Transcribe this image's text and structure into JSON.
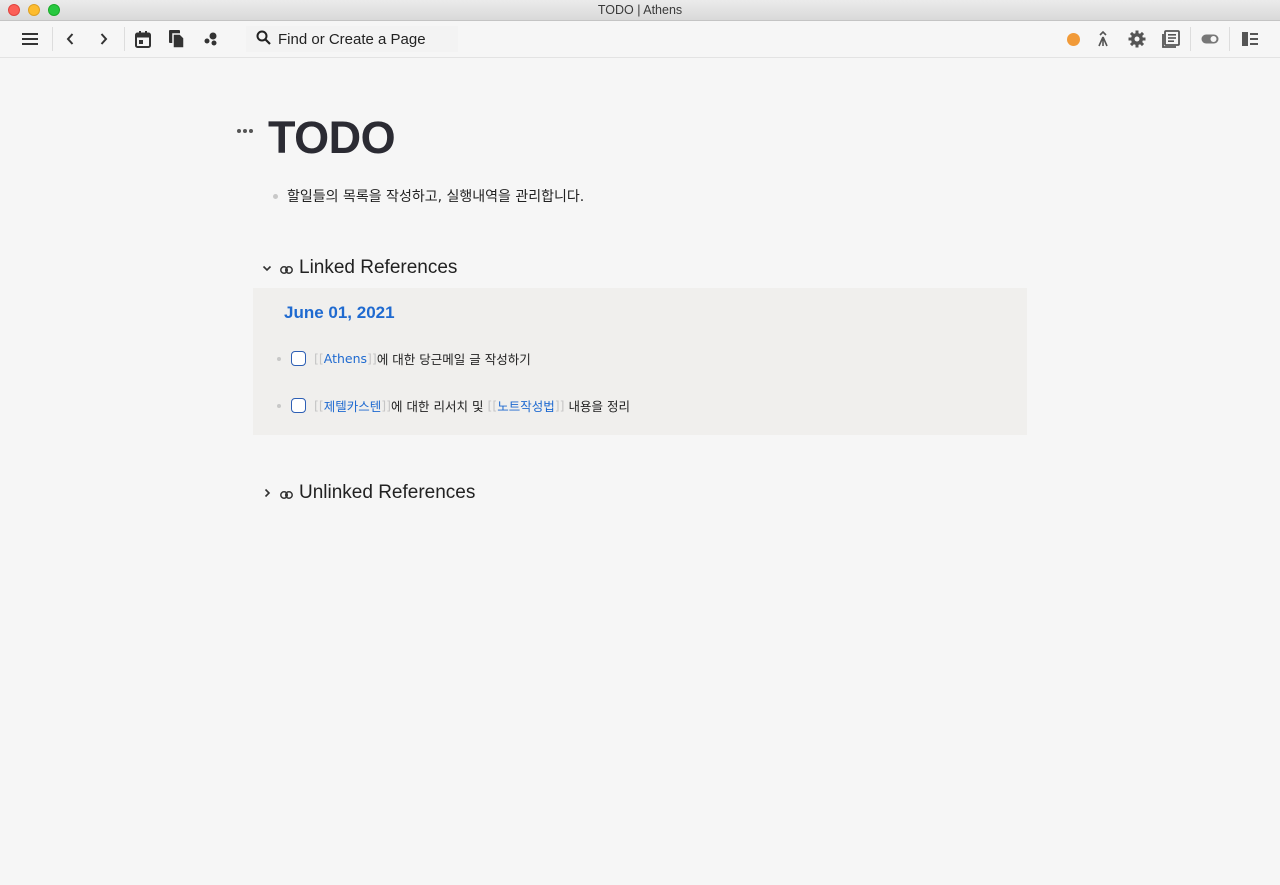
{
  "window": {
    "title": "TODO | Athens"
  },
  "toolbar": {
    "search_placeholder": "Find or Create a Page",
    "icons": [
      "menu-icon",
      "back-icon",
      "forward-icon",
      "calendar-icon",
      "pages-icon",
      "graph-icon",
      "search-icon",
      "status-dot",
      "merge-icon",
      "gear-icon",
      "library-icon",
      "toggle-icon",
      "sidebar-icon"
    ],
    "status_color": "#f19a38"
  },
  "page": {
    "title": "TODO",
    "blocks": [
      {
        "text": "할일들의 목록을 작성하고, 실행내역을 관리합니다."
      }
    ]
  },
  "linked_references": {
    "label": "Linked References",
    "expanded": true,
    "groups": [
      {
        "date": "June 01, 2021",
        "items": [
          {
            "open": "[[",
            "link": "Athens",
            "close": "]]",
            "rest": "에 대한 당근메일 글 작성하기",
            "checked": false
          },
          {
            "open": "[[",
            "link": "제텔카스텐",
            "close": "]]",
            "rest": "에 대한 리서치 및 ",
            "open2": "[[",
            "link2": "노트작성법",
            "close2": "]]",
            "rest2": " 내용을 정리",
            "checked": false
          }
        ]
      }
    ]
  },
  "unlinked_references": {
    "label": "Unlinked References",
    "expanded": false
  },
  "colors": {
    "link": "#1f6ad0",
    "accent": "#f19a38"
  }
}
